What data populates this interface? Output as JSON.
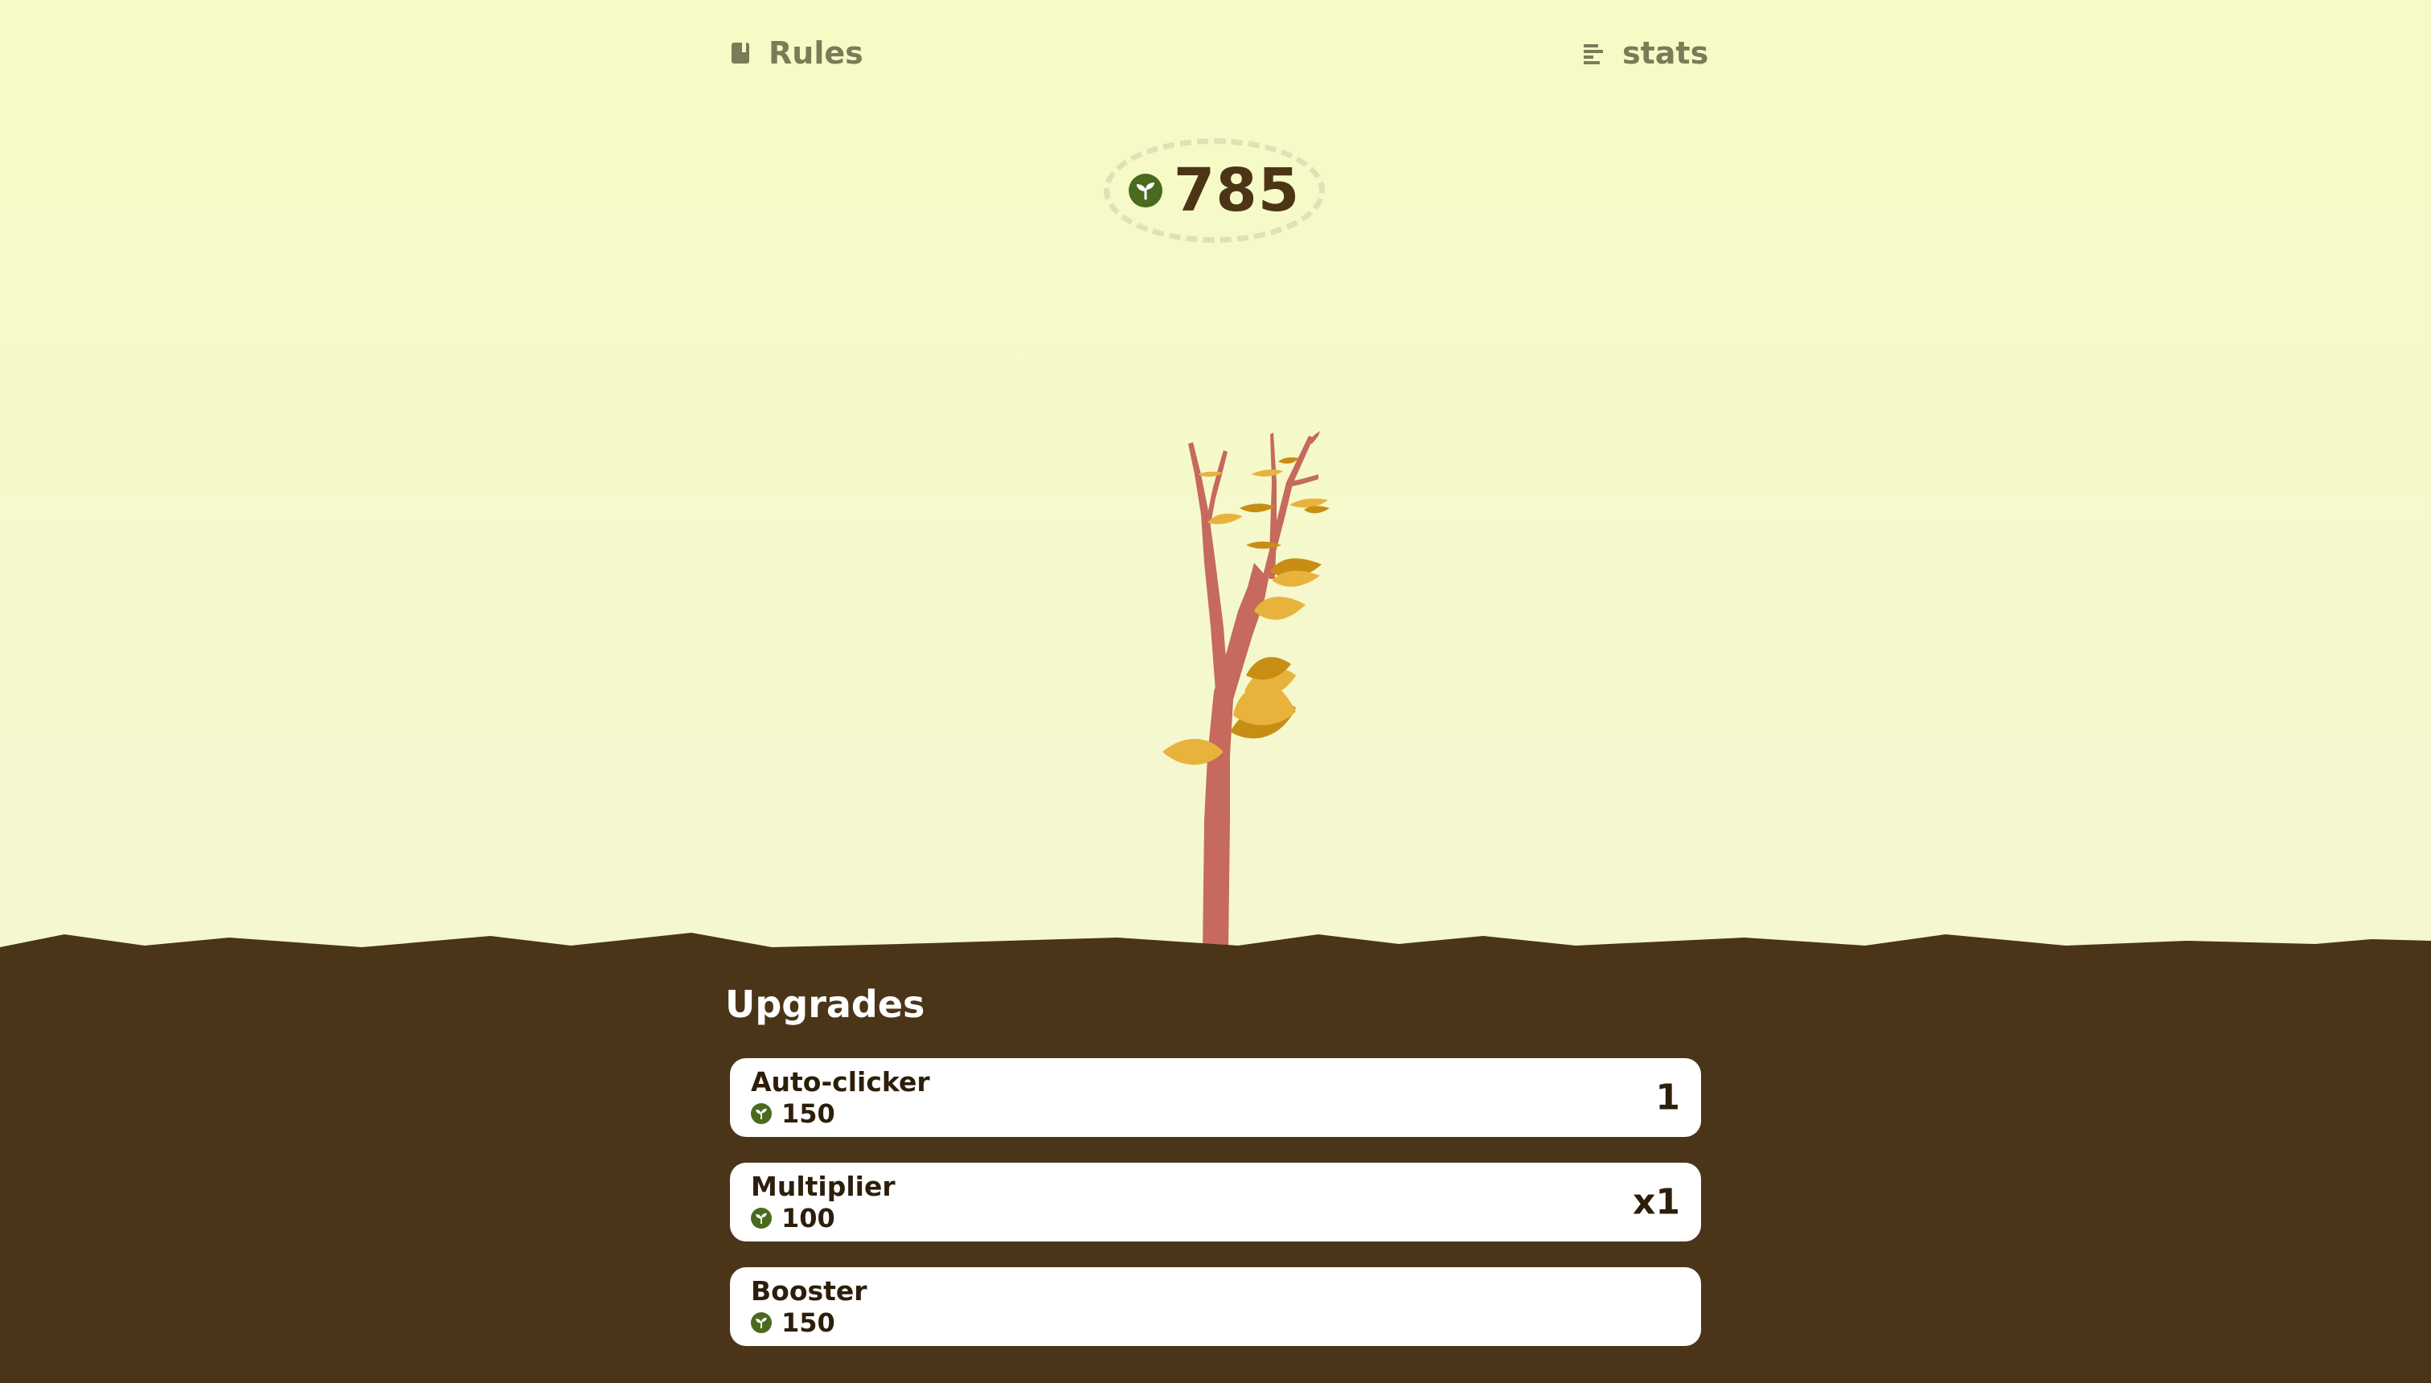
{
  "nav": {
    "rules": {
      "label": "Rules",
      "icon": "book-icon"
    },
    "stats": {
      "label": "stats",
      "icon": "bar-chart-icon"
    }
  },
  "score": {
    "value": "785",
    "icon": "seed-coin-icon"
  },
  "upgrades": {
    "title": "Upgrades",
    "items": [
      {
        "name": "Auto-clicker",
        "cost": "150",
        "level": "1"
      },
      {
        "name": "Multiplier",
        "cost": "100",
        "level": "x1"
      },
      {
        "name": "Booster",
        "cost": "150",
        "level": ""
      }
    ]
  },
  "colors": {
    "sky_top": "#f6fbc5",
    "sky_bottom": "#f4f5d5",
    "ground": "#4b3519",
    "trunk": "#c56a5c",
    "leaf_light": "#e8b33d",
    "leaf_dark": "#c88e14",
    "coin": "#4a6a1f",
    "nav_text": "#7b7b57",
    "score_text": "#4b3516"
  }
}
